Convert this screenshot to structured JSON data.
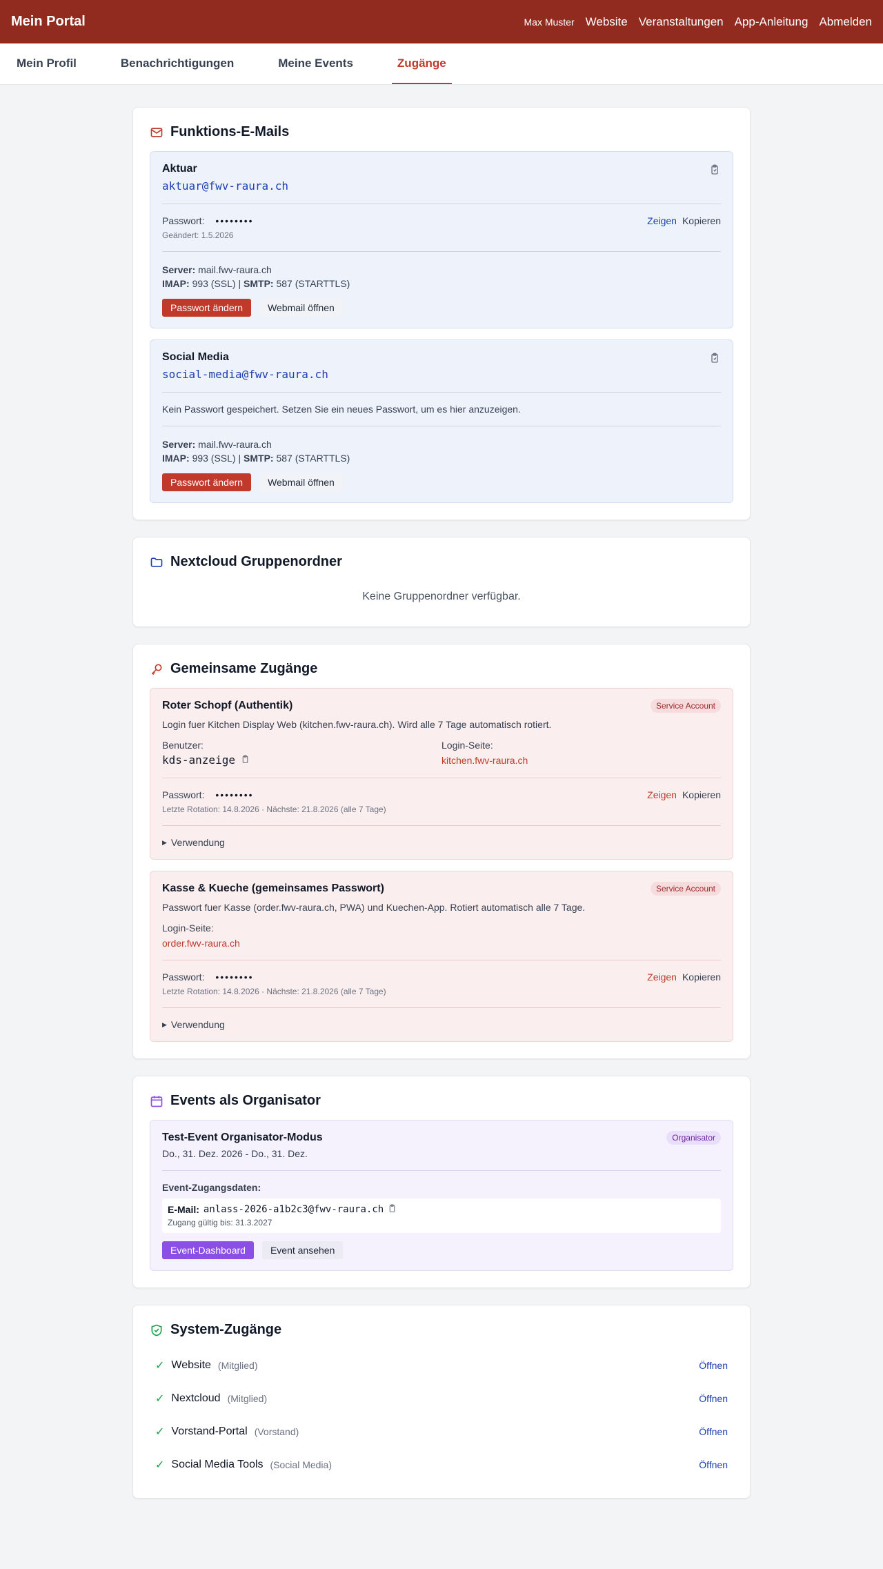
{
  "header": {
    "brand": "Mein Portal",
    "user": "Max Muster",
    "nav": [
      "Website",
      "Veranstaltungen",
      "App-Anleitung",
      "Abmelden"
    ]
  },
  "tabs": [
    "Mein Profil",
    "Benachrichtigungen",
    "Meine Events",
    "Zugänge"
  ],
  "active_tab": "Zugänge",
  "functional_emails": {
    "title": "Funktions-E-Mails",
    "password_label": "Passwort:",
    "show_label": "Zeigen",
    "copy_label": "Kopieren",
    "server_label": "Server:",
    "server_value": "mail.fwv-raura.ch",
    "imap_label": "IMAP:",
    "imap_value": "993 (SSL) |",
    "smtp_label": "SMTP:",
    "smtp_value": "587 (STARTTLS)",
    "change_pw_label": "Passwort ändern",
    "webmail_label": "Webmail öffnen",
    "accounts": [
      {
        "name": "Aktuar",
        "email": "aktuar@fwv-raura.ch",
        "password_masked": "••••••••",
        "changed": "Geändert: 1.5.2026"
      },
      {
        "name": "Social Media",
        "email": "social-media@fwv-raura.ch",
        "no_password_note": "Kein Passwort gespeichert. Setzen Sie ein neues Passwort, um es hier anzuzeigen."
      }
    ]
  },
  "nextcloud": {
    "title": "Nextcloud Gruppenordner",
    "empty": "Keine Gruppenordner verfügbar."
  },
  "shared": {
    "title": "Gemeinsame Zugänge",
    "badge": "Service Account",
    "user_label": "Benutzer:",
    "login_label": "Login-Seite:",
    "password_label": "Passwort:",
    "show_label": "Zeigen",
    "copy_label": "Kopieren",
    "usage_label": "Verwendung",
    "items": [
      {
        "name": "Roter Schopf (Authentik)",
        "desc": "Login fuer Kitchen Display Web (kitchen.fwv-raura.ch). Wird alle 7 Tage automatisch rotiert.",
        "user": "kds-anzeige",
        "login": "kitchen.fwv-raura.ch",
        "password_masked": "••••••••",
        "rotation": "Letzte Rotation: 14.8.2026 · Nächste: 21.8.2026 (alle 7 Tage)"
      },
      {
        "name": "Kasse & Kueche (gemeinsames Passwort)",
        "desc": "Passwort fuer Kasse (order.fwv-raura.ch, PWA) und Kuechen-App. Rotiert automatisch alle 7 Tage.",
        "login": "order.fwv-raura.ch",
        "password_masked": "••••••••",
        "rotation": "Letzte Rotation: 14.8.2026 · Nächste: 21.8.2026 (alle 7 Tage)"
      }
    ]
  },
  "organizer": {
    "title": "Events als Organisator",
    "event_name": "Test-Event Organisator-Modus",
    "badge": "Organisator",
    "date": "Do., 31. Dez. 2026 - Do., 31. Dez.",
    "access_title": "Event-Zugangsdaten:",
    "email_label": "E-Mail:",
    "email": "anlass-2026-a1b2c3@fwv-raura.ch",
    "valid": "Zugang gültig bis: 31.3.2027",
    "dashboard_label": "Event-Dashboard",
    "view_label": "Event ansehen"
  },
  "system": {
    "title": "System-Zugänge",
    "open_label": "Öffnen",
    "items": [
      {
        "name": "Website",
        "role": "(Mitglied)"
      },
      {
        "name": "Nextcloud",
        "role": "(Mitglied)"
      },
      {
        "name": "Vorstand-Portal",
        "role": "(Vorstand)"
      },
      {
        "name": "Social Media Tools",
        "role": "(Social Media)"
      }
    ]
  },
  "colors": {
    "brand": "#922b1f",
    "accent_red": "#c0392b",
    "link_blue": "#1e40af",
    "purple": "#8b4fe6",
    "success": "#16a34a"
  }
}
